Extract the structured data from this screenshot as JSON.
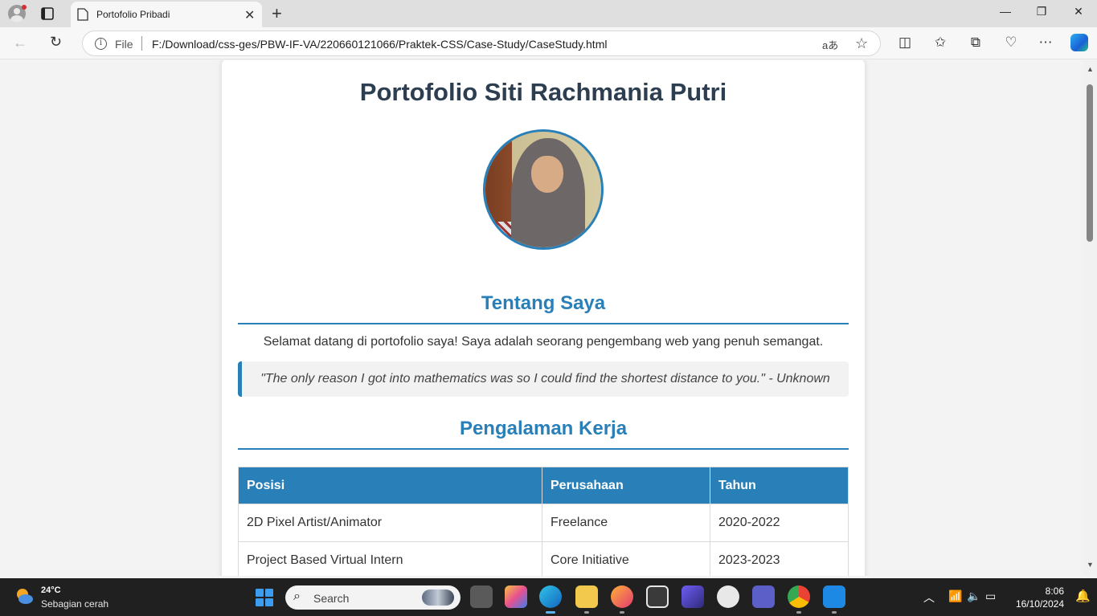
{
  "browser": {
    "tab_title": "Portofolio Pribadi",
    "new_tab_symbol": "+",
    "url_scheme": "File",
    "url": "F:/Download/css-ges/PBW-IF-VA/220660121066/Praktek-CSS/Case-Study/CaseStudy.html",
    "read_aloud_glyph": "aあ"
  },
  "page": {
    "title": "Portofolio Siti Rachmania Putri",
    "about": {
      "heading": "Tentang Saya",
      "text": "Selamat datang di portofolio saya! Saya adalah seorang pengembang web yang penuh semangat.",
      "quote": "\"The only reason I got into mathematics was so I could find the shortest distance to you.\" - Unknown"
    },
    "experience": {
      "heading": "Pengalaman Kerja",
      "columns": [
        "Posisi",
        "Perusahaan",
        "Tahun"
      ],
      "rows": [
        [
          "2D Pixel Artist/Animator",
          "Freelance",
          "2020-2022"
        ],
        [
          "Project Based Virtual Intern",
          "Core Initiative",
          "2023-2023"
        ]
      ]
    }
  },
  "taskbar": {
    "weather_temp": "24°C",
    "weather_desc": "Sebagian cerah",
    "search_placeholder": "Search",
    "time": "8:06",
    "date": "16/10/2024"
  },
  "colors": {
    "accent": "#2980b9",
    "heading": "#2c3e50"
  }
}
